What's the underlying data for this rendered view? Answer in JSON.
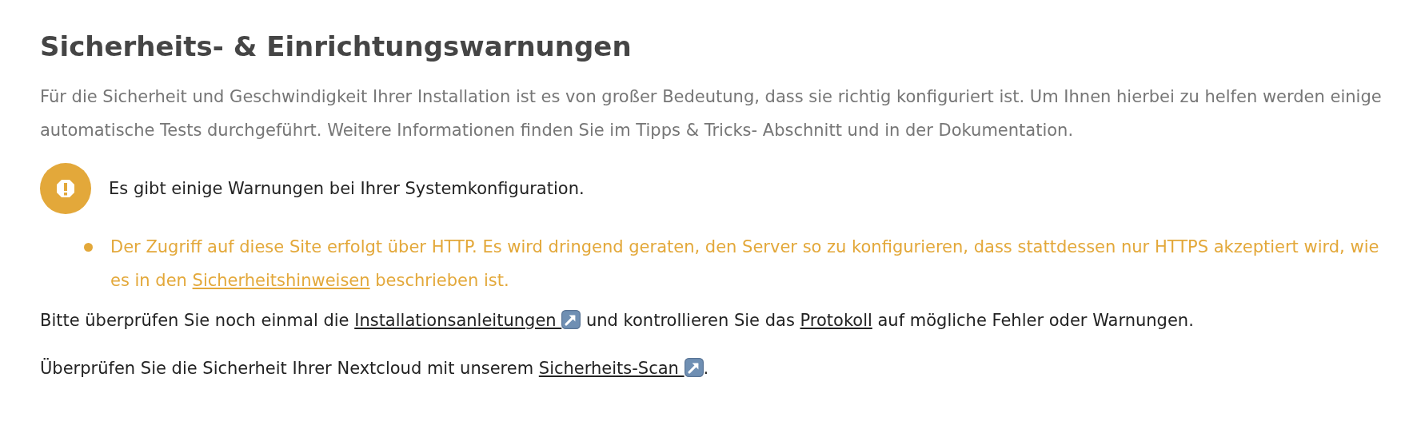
{
  "heading": "Sicherheits- & Einrichtungswarnungen",
  "intro": "Für die Sicherheit und Geschwindigkeit Ihrer Installation ist es von großer Bedeutung, dass sie richtig konfiguriert ist. Um Ihnen hierbei zu helfen werden einige automatische Tests durchgeführt. Weitere Informationen finden Sie im Tipps & Tricks- Abschnitt und in der Dokumentation.",
  "status": {
    "kind": "warning",
    "message": "Es gibt einige Warnungen bei Ihrer Systemkonfiguration."
  },
  "warnings": [
    [
      {
        "text": "Der Zugriff auf diese Site erfolgt über HTTP. Es wird dringend geraten, den Server so zu konfigurieren, dass stattdessen nur HTTPS akzeptiert wird, wie es in den "
      },
      {
        "link": "Sicherheitshinweisen",
        "external": false
      },
      {
        "text": " beschrieben ist."
      }
    ]
  ],
  "paragraphs": [
    [
      {
        "text": "Bitte überprüfen Sie noch einmal die "
      },
      {
        "link": "Installationsanleitungen",
        "external": true
      },
      {
        "text": " und kontrollieren Sie das "
      },
      {
        "link": "Protokoll",
        "external": false
      },
      {
        "text": " auf mögliche Fehler oder Warnungen."
      }
    ],
    [
      {
        "text": "Überprüfen Sie die Sicherheit Ihrer Nextcloud mit unserem "
      },
      {
        "link": "Sicherheits-Scan",
        "external": true
      },
      {
        "text": "."
      }
    ]
  ]
}
